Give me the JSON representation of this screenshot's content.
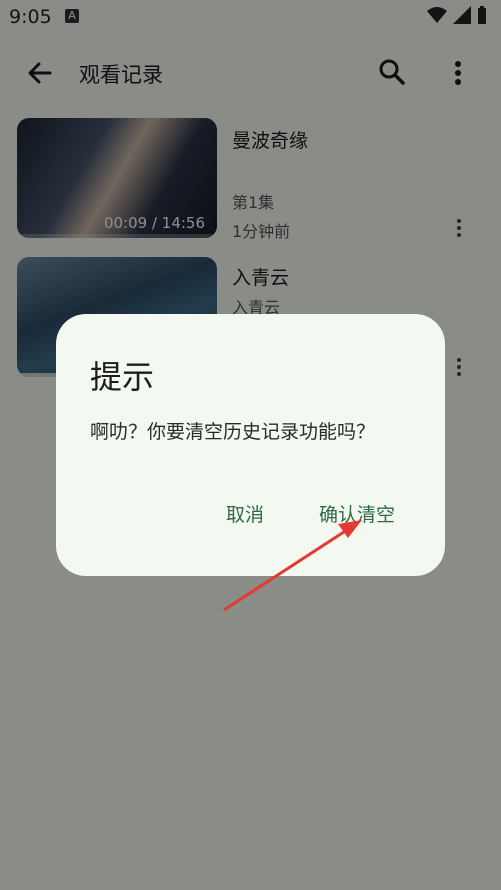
{
  "status_bar": {
    "time": "9:05",
    "notification_icon": "A"
  },
  "app_bar": {
    "title": "观看记录"
  },
  "history": [
    {
      "title": "曼波奇缘",
      "episode": "第1集",
      "watched": "1分钟前",
      "progress_text": "00:09 / 14:56",
      "progress_fraction": 0.01
    },
    {
      "title": "入青云",
      "episode": "入青云"
    }
  ],
  "dialog": {
    "title": "提示",
    "message": "啊叻？你要清空历史记录功能吗？",
    "cancel_label": "取消",
    "confirm_label": "确认清空"
  },
  "colors": {
    "accent": "#2e6a44",
    "annotation_arrow": "#e53935",
    "scrim": "rgba(0,0,0,0.44)"
  }
}
